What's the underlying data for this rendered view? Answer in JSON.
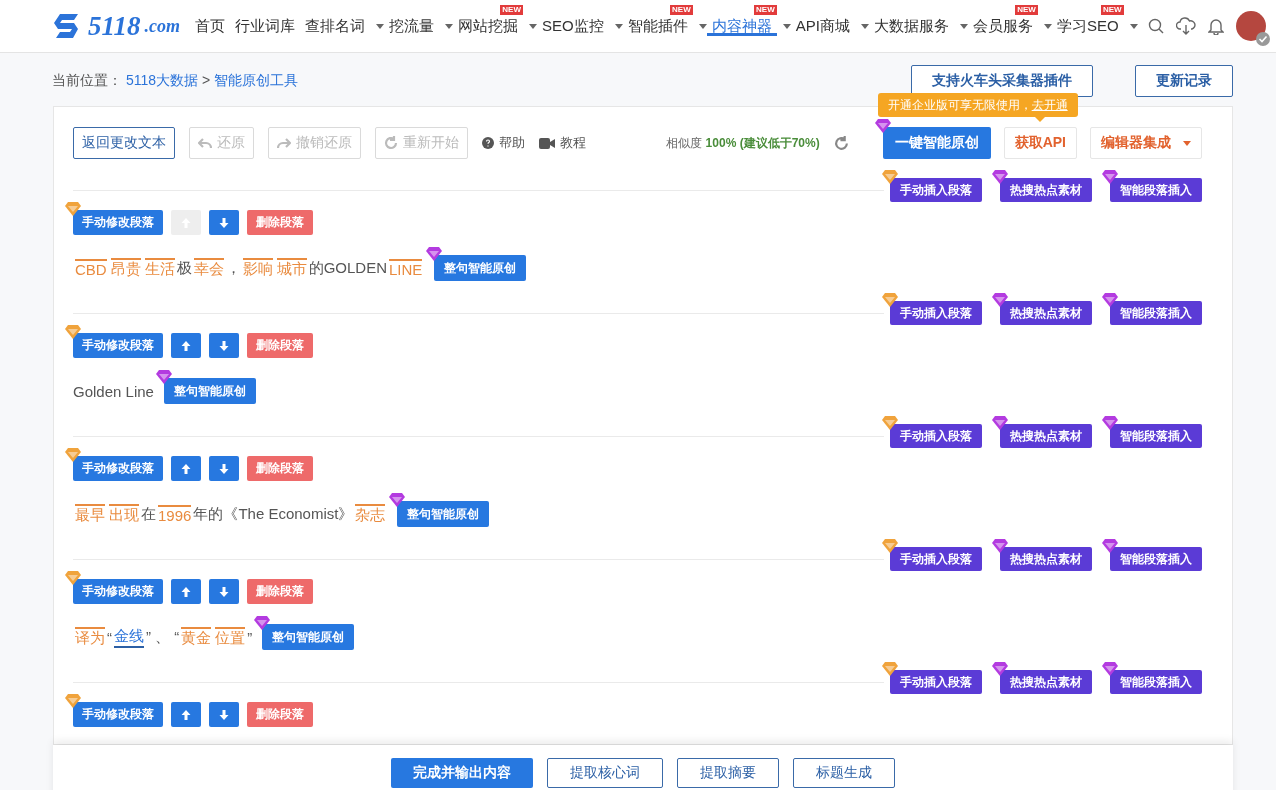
{
  "header": {
    "logo": {
      "name": "5118",
      "suffix": ".com"
    },
    "nav": [
      {
        "label": "首页",
        "dropdown": false,
        "selected": false
      },
      {
        "label": "行业词库",
        "dropdown": false,
        "selected": false
      },
      {
        "label": "查排名词",
        "dropdown": true,
        "selected": false
      },
      {
        "label": "挖流量",
        "dropdown": true,
        "selected": false
      },
      {
        "label": "网站挖掘",
        "dropdown": true,
        "badge": "NEW",
        "selected": false
      },
      {
        "label": "SEO监控",
        "dropdown": true,
        "selected": false
      },
      {
        "label": "智能插件",
        "dropdown": true,
        "badge": "NEW",
        "selected": false
      },
      {
        "label": "内容神器",
        "dropdown": true,
        "badge": "NEW",
        "selected": true
      },
      {
        "label": "API商城",
        "dropdown": true,
        "selected": false
      },
      {
        "label": "大数据服务",
        "dropdown": true,
        "selected": false
      },
      {
        "label": "会员服务",
        "dropdown": true,
        "badge": "NEW",
        "selected": false
      },
      {
        "label": "学习SEO",
        "dropdown": true,
        "badge": "NEW",
        "selected": false
      }
    ]
  },
  "breadcrumb": {
    "prefix": "当前位置：",
    "links": [
      "5118大数据",
      "智能原创工具"
    ],
    "separator": ">"
  },
  "top_buttons": [
    "支持火车头采集器插件",
    "更新记录"
  ],
  "toolbar": {
    "back": "返回更改文本",
    "undo": {
      "label": "还原",
      "disabled": true
    },
    "redo": {
      "label": "撤销还原",
      "disabled": true
    },
    "restart": {
      "label": "重新开始",
      "disabled": true
    },
    "help": "帮助",
    "tutorial": "教程",
    "similarity_label": "相似度",
    "similarity_value": "100% (建议低于70%)",
    "rewrite_all": "一键智能原创",
    "api": "获取API",
    "editor": "编辑器集成",
    "tooltip": {
      "text": "开通企业版可享无限使用，",
      "link": "去开通"
    }
  },
  "blocks": [
    {
      "insert_buttons": [
        "手动插入段落",
        "热搜热点素材",
        "智能段落插入"
      ],
      "paragraph": {
        "edit": "手动修改段落",
        "up_disabled": true,
        "down_disabled": false,
        "delete": "删除段落",
        "rewrite": "整句智能原创",
        "segments": [
          {
            "text": "CBD",
            "kind": "replaced"
          },
          {
            "text": "昂贵",
            "kind": "replaced"
          },
          {
            "text": "生活",
            "kind": "replaced"
          },
          {
            "text": "极",
            "kind": "plain"
          },
          {
            "text": "幸会",
            "kind": "replaced"
          },
          {
            "text": "，",
            "kind": "plain"
          },
          {
            "text": "影响",
            "kind": "replaced"
          },
          {
            "text": "城市",
            "kind": "replaced"
          },
          {
            "text": "的GOLDEN",
            "kind": "plain"
          },
          {
            "text": "LINE",
            "kind": "replaced"
          }
        ]
      }
    },
    {
      "insert_buttons": [
        "手动插入段落",
        "热搜热点素材",
        "智能段落插入"
      ],
      "paragraph": {
        "edit": "手动修改段落",
        "up_disabled": false,
        "down_disabled": false,
        "delete": "删除段落",
        "rewrite": "整句智能原创",
        "segments": [
          {
            "text": "Golden Line",
            "kind": "plain"
          }
        ]
      }
    },
    {
      "insert_buttons": [
        "手动插入段落",
        "热搜热点素材",
        "智能段落插入"
      ],
      "paragraph": {
        "edit": "手动修改段落",
        "up_disabled": false,
        "down_disabled": false,
        "delete": "删除段落",
        "rewrite": "整句智能原创",
        "segments": [
          {
            "text": "最早",
            "kind": "replaced"
          },
          {
            "text": "出现",
            "kind": "replaced"
          },
          {
            "text": "在",
            "kind": "plain"
          },
          {
            "text": "1996",
            "kind": "replaced"
          },
          {
            "text": "年的《The Economist》",
            "kind": "plain"
          },
          {
            "text": "杂志",
            "kind": "replaced"
          }
        ]
      }
    },
    {
      "insert_buttons": [
        "手动插入段落",
        "热搜热点素材",
        "智能段落插入"
      ],
      "paragraph": {
        "edit": "手动修改段落",
        "up_disabled": false,
        "down_disabled": false,
        "delete": "删除段落",
        "rewrite": "整句智能原创",
        "segments": [
          {
            "text": "译为",
            "kind": "replaced"
          },
          {
            "text": "“",
            "kind": "plain"
          },
          {
            "text": "金线",
            "kind": "linked"
          },
          {
            "text": "” 、 “",
            "kind": "plain"
          },
          {
            "text": "黄金",
            "kind": "replaced"
          },
          {
            "text": "位置",
            "kind": "replaced"
          },
          {
            "text": "”",
            "kind": "plain"
          }
        ]
      }
    },
    {
      "insert_buttons": [
        "手动插入段落",
        "热搜热点素材",
        "智能段落插入"
      ],
      "paragraph": {
        "edit": "手动修改段落",
        "up_disabled": false,
        "down_disabled": false,
        "delete": "删除段落"
      }
    }
  ],
  "footer": {
    "buttons": [
      {
        "label": "完成并输出内容",
        "kind": "primary"
      },
      {
        "label": "提取核心词",
        "kind": "outline"
      },
      {
        "label": "提取摘要",
        "kind": "outline"
      },
      {
        "label": "标题生成",
        "kind": "outline"
      }
    ]
  }
}
